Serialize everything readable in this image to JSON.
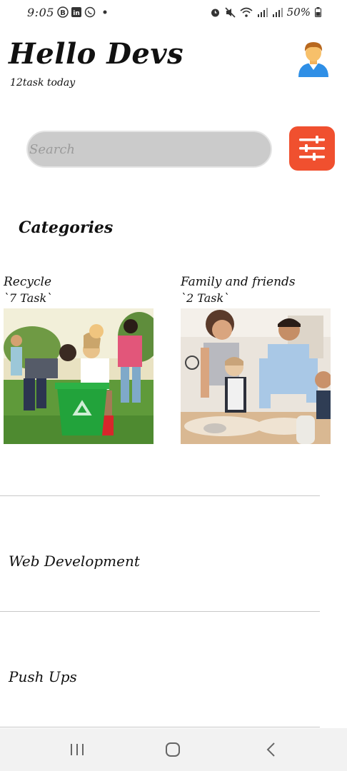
{
  "status_bar": {
    "time": "9:05",
    "app_icons": [
      "b-icon",
      "linkedin-icon",
      "whatsapp-icon",
      "dot-icon"
    ],
    "right_icons": [
      "alarm-icon",
      "mute-icon",
      "wifi-icon",
      "signal-icon",
      "signal-icon"
    ],
    "battery_text": "50%"
  },
  "header": {
    "title": "Hello Devs",
    "subtitle": "12task today",
    "avatar_icon": "user-avatar-icon"
  },
  "search": {
    "placeholder": "Search",
    "filter_icon": "sliders-icon"
  },
  "categories": {
    "title": "Categories",
    "items": [
      {
        "name": "Recycle",
        "count": "`7 Task`",
        "image": "recycle-photo"
      },
      {
        "name": "Family and friends",
        "count": "`2 Task`",
        "image": "family-photo"
      }
    ]
  },
  "tasks": [
    {
      "label": "Web Development"
    },
    {
      "label": "Push Ups"
    }
  ],
  "colors": {
    "accent": "#f0502f",
    "search_bg": "#cbcbcb",
    "divider": "#c8c8c8"
  },
  "nav_bar": {
    "icons": [
      "recent-apps-icon",
      "home-icon",
      "back-icon"
    ]
  }
}
